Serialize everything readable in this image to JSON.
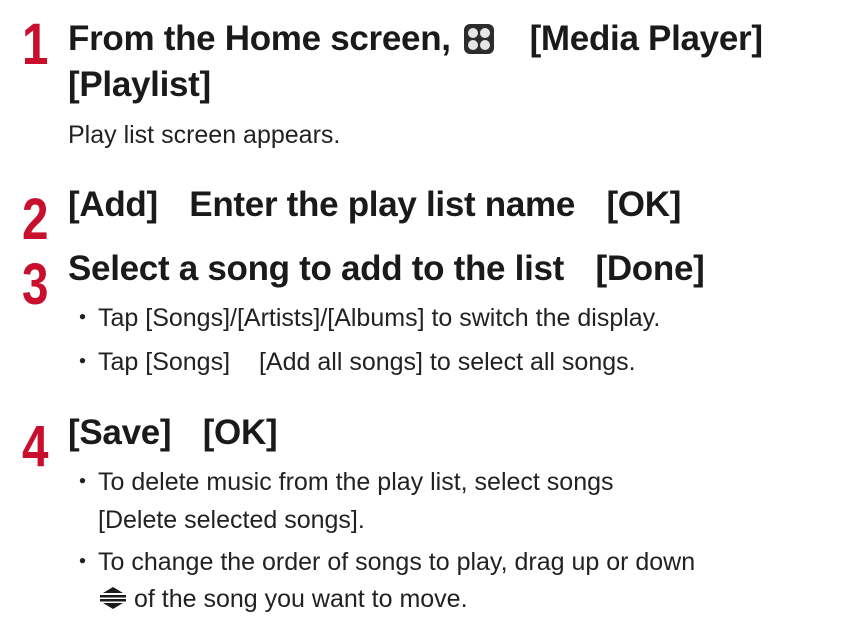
{
  "steps": [
    {
      "number": "1",
      "line1_part1": "From the Home screen,",
      "line1_part2": "[Media Player]",
      "line2": "[Playlist]",
      "icon": "app-grid-icon",
      "description": "Play list screen appears."
    },
    {
      "number": "2",
      "part1": "[Add]",
      "part2": "Enter the play list name",
      "part3": "[OK]"
    },
    {
      "number": "3",
      "part1": "Select a song to add to the list",
      "part2": "[Done]",
      "bullets": [
        "Tap [Songs]/[Artists]/[Albums] to switch the display.",
        "Tap [Songs]",
        "[Add all songs] to select all songs."
      ]
    },
    {
      "number": "4",
      "part1": "[Save]",
      "part2": "[OK]",
      "bullet1_line1": "To delete music from the play list, select songs",
      "bullet1_line2": "[Delete selected songs].",
      "bullet2_line1": "To change the order of songs to play, drag up or down",
      "bullet2_line2": "of the song you want to move.",
      "icon": "reorder-icon"
    }
  ],
  "bullet_glyph": "・",
  "accent_color": "#c8102e"
}
